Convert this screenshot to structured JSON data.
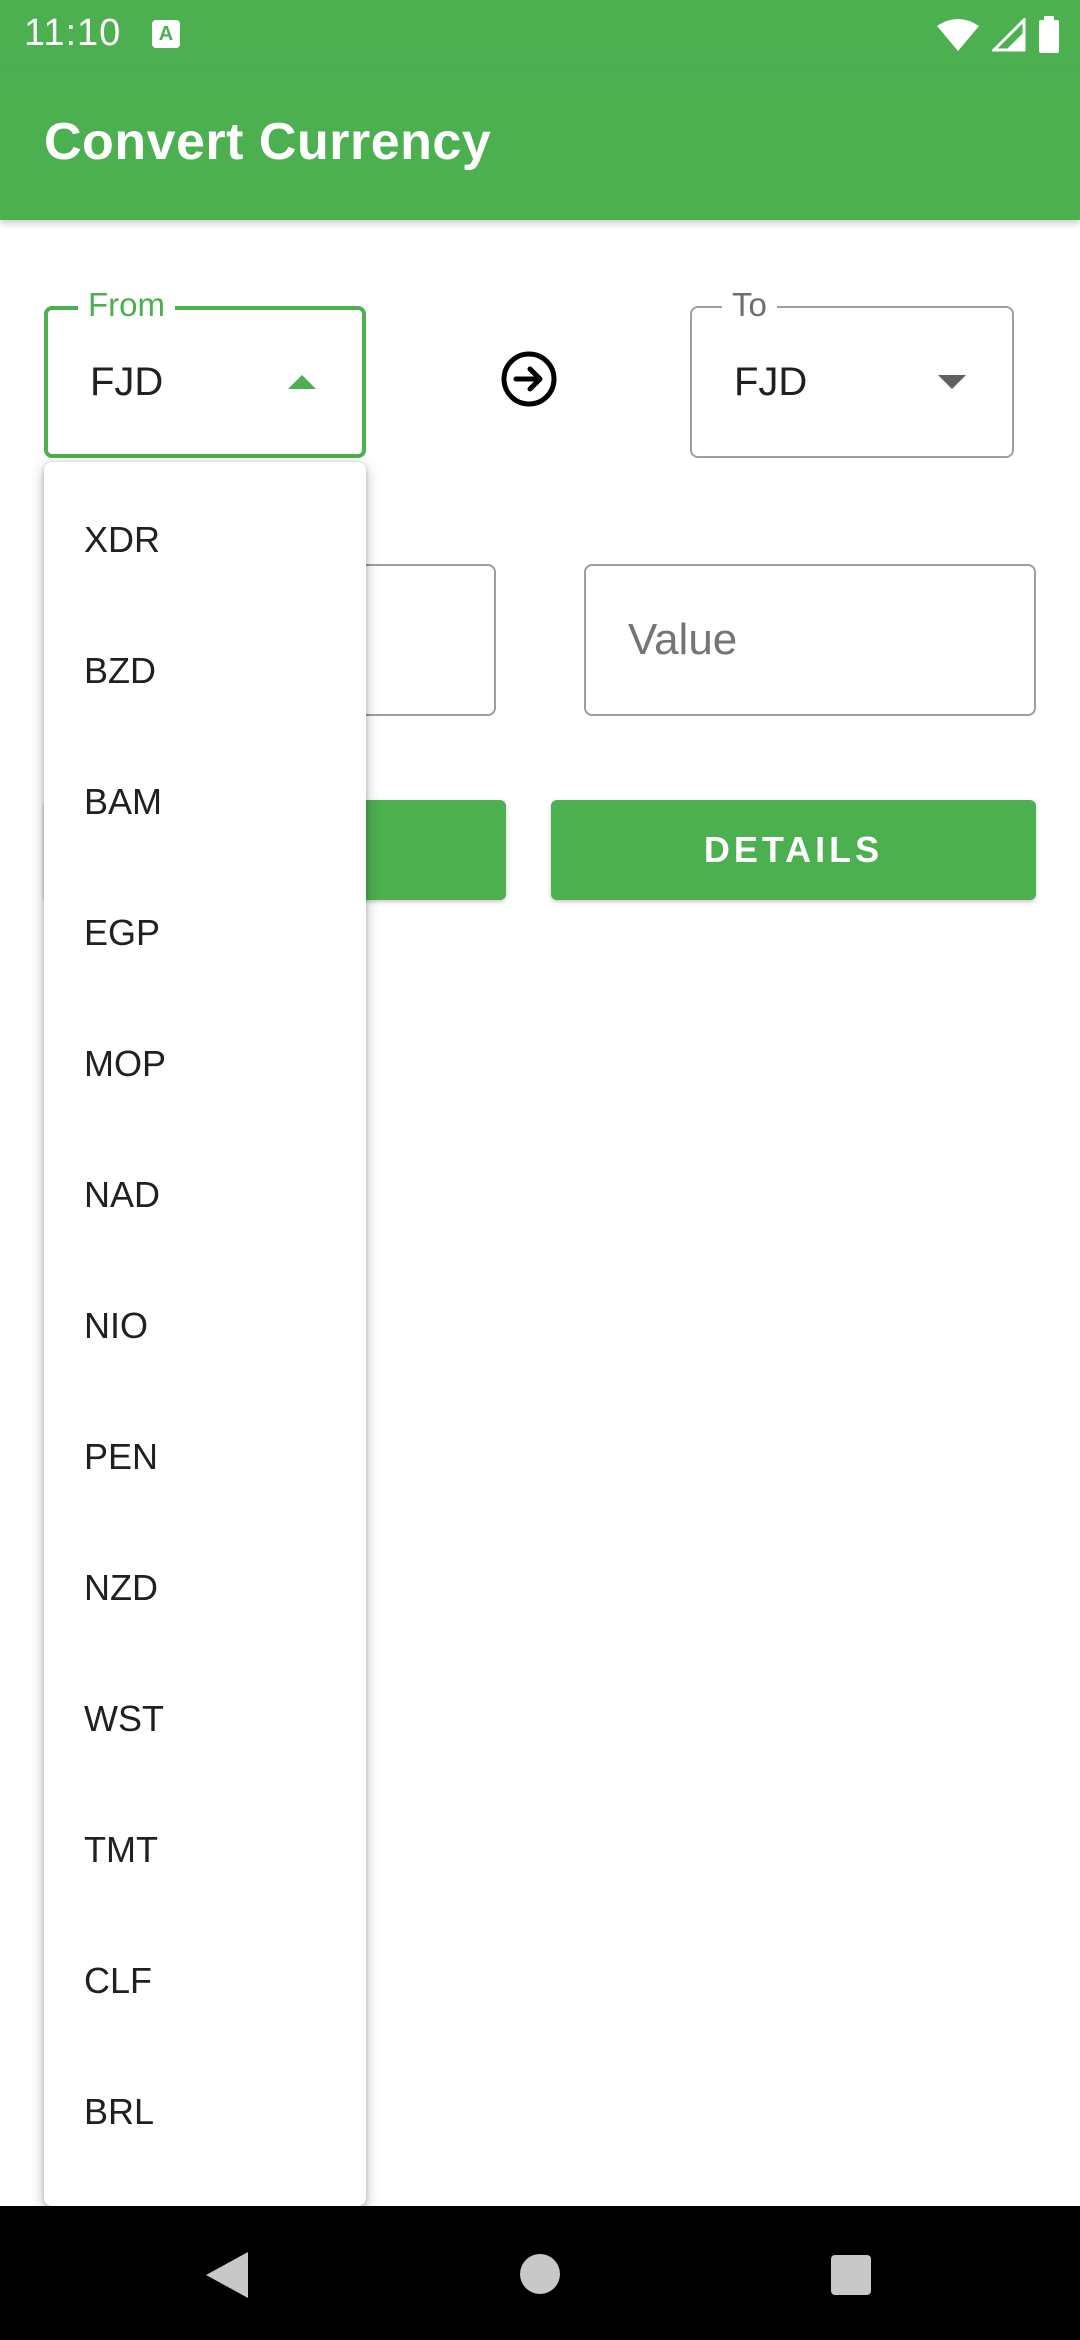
{
  "status_bar": {
    "time": "11:10",
    "notification_icon": "A"
  },
  "app_bar": {
    "title": "Convert Currency"
  },
  "from_field": {
    "label": "From",
    "value": "FJD"
  },
  "to_field": {
    "label": "To",
    "value": "FJD"
  },
  "amount_input": {
    "value": ""
  },
  "value_output": {
    "placeholder": "Value"
  },
  "buttons": {
    "convert_label": "",
    "details_label": "DETAILS"
  },
  "dropdown": {
    "options": [
      "XDR",
      "BZD",
      "BAM",
      "EGP",
      "MOP",
      "NAD",
      "NIO",
      "PEN",
      "NZD",
      "WST",
      "TMT",
      "CLF",
      "BRL"
    ]
  },
  "colors": {
    "primary": "#4caf50",
    "nav_bar": "#000000"
  },
  "icons": [
    "wifi-icon",
    "signal-icon",
    "battery-icon",
    "arrow-circle-right-icon",
    "back-icon",
    "home-icon",
    "recents-icon"
  ]
}
